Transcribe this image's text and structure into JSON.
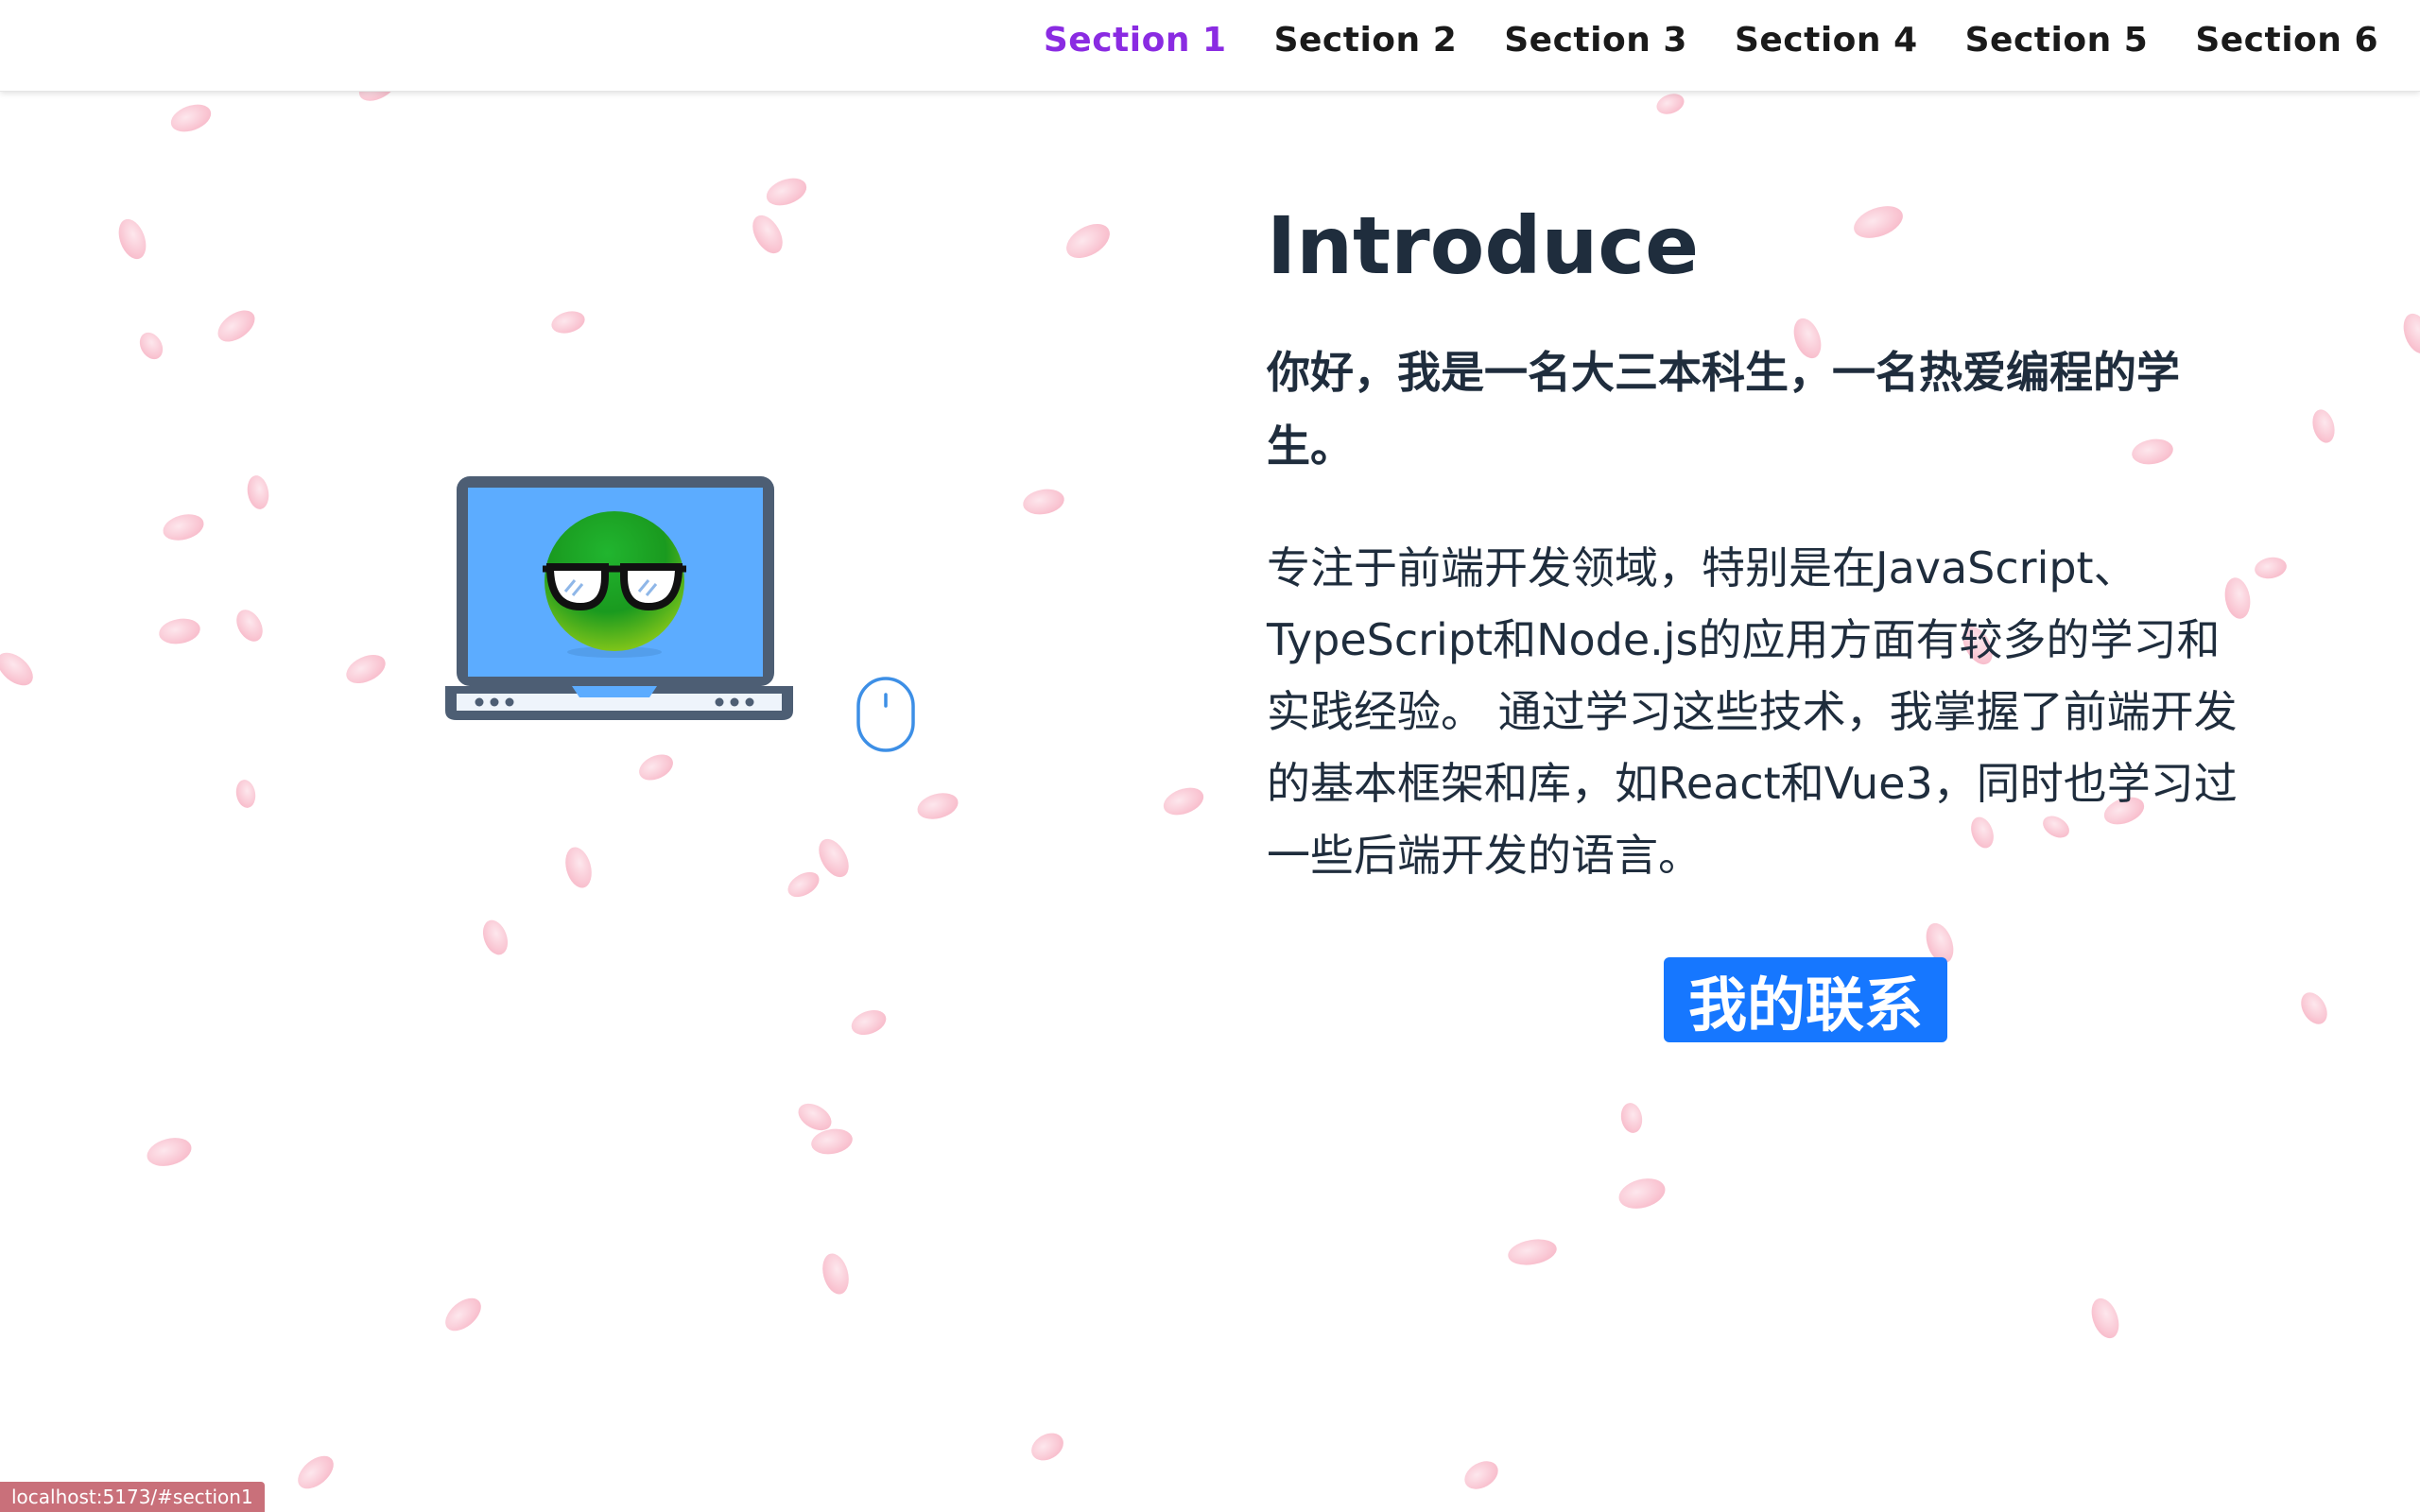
{
  "nav": {
    "items": [
      {
        "label": "Section 1",
        "active": true
      },
      {
        "label": "Section 2",
        "active": false
      },
      {
        "label": "Section 3",
        "active": false
      },
      {
        "label": "Section 4",
        "active": false
      },
      {
        "label": "Section 5",
        "active": false
      },
      {
        "label": "Section 6",
        "active": false
      }
    ],
    "active_color": "#8a2be2"
  },
  "intro": {
    "title": "Introduce",
    "headline": "你好，我是一名大三本科生，一名热爱编程的学生。",
    "body": "专注于前端开发领域，特别是在JavaScript、TypeScript和Node.js的应用方面有较多的学习和实践经验。 通过学习这些技术，我掌握了前端开发的基本框架和库，如React和Vue3，同时也学习过一些后端开发的语言。",
    "contact_button": "我的联系"
  },
  "illustration": {
    "laptop_icon": "laptop-icon",
    "avatar_icon": "green-face-with-glasses-icon",
    "mouse_icon": "scroll-mouse-icon"
  },
  "status_bar": {
    "url": "localhost:5173/#section1"
  },
  "colors": {
    "button": "#1677ff",
    "text": "#1f2d3d",
    "petal": "#f8b8c8"
  }
}
